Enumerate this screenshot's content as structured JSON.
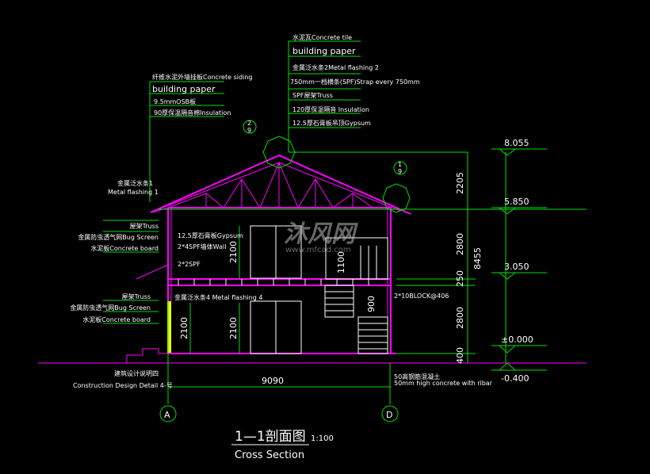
{
  "colors": {
    "background": "#000000",
    "structure": "#ff00ff",
    "leaders": "#00e000",
    "text": "#ffffff",
    "wall": "#ffff00"
  },
  "roof_labels": [
    "水泥瓦Concrete tile",
    "building paper",
    "金属泛水条2Metal flashing 2",
    "750mm一档横条(SPF)Strap every 750mm",
    "SPF屋架Truss",
    "120厚保温隔音 Insulation",
    "12.5厚石膏板吊顶Gypsum"
  ],
  "wall_labels": [
    "纤维水泥外墙挂板Concrete siding",
    "building paper",
    "9.5mmOSB板",
    "90厚保温隔音棉Insulation"
  ],
  "flashing1": {
    "cn": "金属泛水条1",
    "en": "Metal flashing 1"
  },
  "eave_upper": [
    "屋架Truss",
    "金属防虫透气网Bug Screen",
    "水泥板Concrete board"
  ],
  "eave_lower": [
    "屋架Truss",
    "金属防虫透气网Bug Screen",
    "水泥板Concrete board"
  ],
  "interior": {
    "gypsum": "12.5厚石膏板Gypsum",
    "wall": "2*4SPF墙体Wall",
    "spf22": "2*2SPF",
    "flashing4": "金属泛水条4 Metal flashing 4",
    "block": "2*10BLOCK@406"
  },
  "foundation": {
    "cn": "50高钢筋混凝土",
    "en": "50mm high concrete with ribar"
  },
  "detail_ref": {
    "cn": "建筑设计说明四",
    "en": "Construction Design Detail 4-号"
  },
  "dims": {
    "d2205": "2205",
    "d2800a": "2800",
    "d250": "250",
    "d2800b": "2800",
    "d400": "400",
    "total": "8455",
    "h2100a": "2100",
    "h2100b": "2100",
    "h2100c": "2100",
    "h1100": "1100",
    "h900": "900",
    "width": "9090"
  },
  "levels": [
    "8.055",
    "5.850",
    "3.050",
    "±0.000",
    "-0.400"
  ],
  "axes": [
    "A",
    "D"
  ],
  "callouts": [
    {
      "num": "2",
      "sheet": "9"
    },
    {
      "num": "1",
      "sheet": "9"
    }
  ],
  "title": {
    "main": "1—1剖面图",
    "scale": "1:100",
    "sub": "Cross Section"
  },
  "watermark": {
    "cn": "沐风网",
    "url": "www.mfcad.com"
  }
}
